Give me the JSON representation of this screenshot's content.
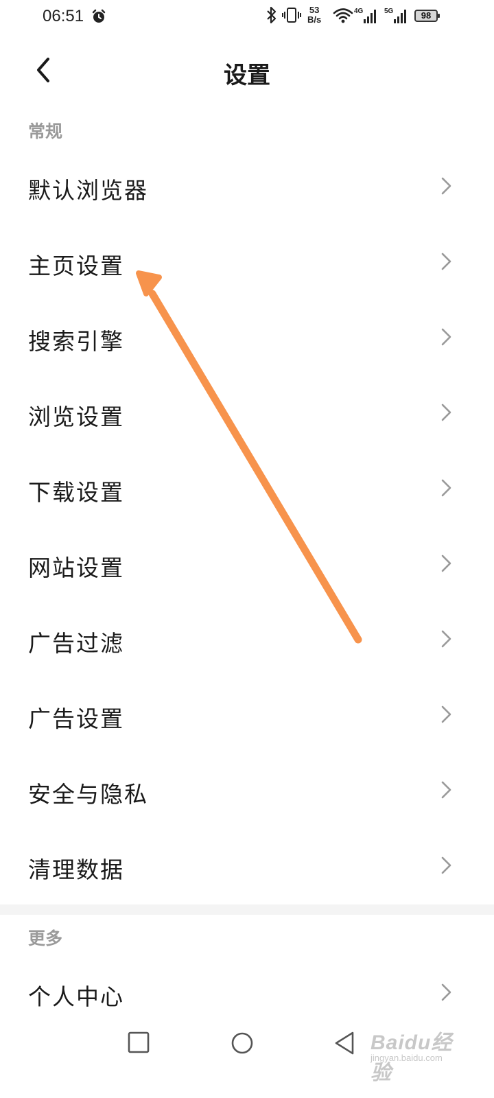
{
  "status_bar": {
    "time": "06:51",
    "net_speed_value": "53",
    "net_speed_unit": "B/s",
    "signal_1_label": "4G",
    "signal_2_label": "5G",
    "battery": "98",
    "icons": [
      "alarm-icon",
      "bluetooth-icon",
      "vibrate-icon",
      "wifi-icon",
      "signal-icon",
      "battery-icon"
    ]
  },
  "header": {
    "title": "设置"
  },
  "sections": {
    "general": {
      "title": "常规",
      "items": [
        {
          "label": "默认浏览器"
        },
        {
          "label": "主页设置"
        },
        {
          "label": "搜索引擎"
        },
        {
          "label": "浏览设置"
        },
        {
          "label": "下载设置"
        },
        {
          "label": "网站设置"
        },
        {
          "label": "广告过滤"
        },
        {
          "label": "广告设置"
        },
        {
          "label": "安全与隐私"
        },
        {
          "label": "清理数据"
        }
      ]
    },
    "more": {
      "title": "更多",
      "items": [
        {
          "label": "个人中心"
        }
      ]
    }
  },
  "watermark": {
    "logo_text": "Baidu经验",
    "url": "jingyan.baidu.com"
  },
  "colors": {
    "annotation_arrow": "#f7934c",
    "section_title": "#9a9a9a",
    "chevron": "#9a9a9a"
  }
}
